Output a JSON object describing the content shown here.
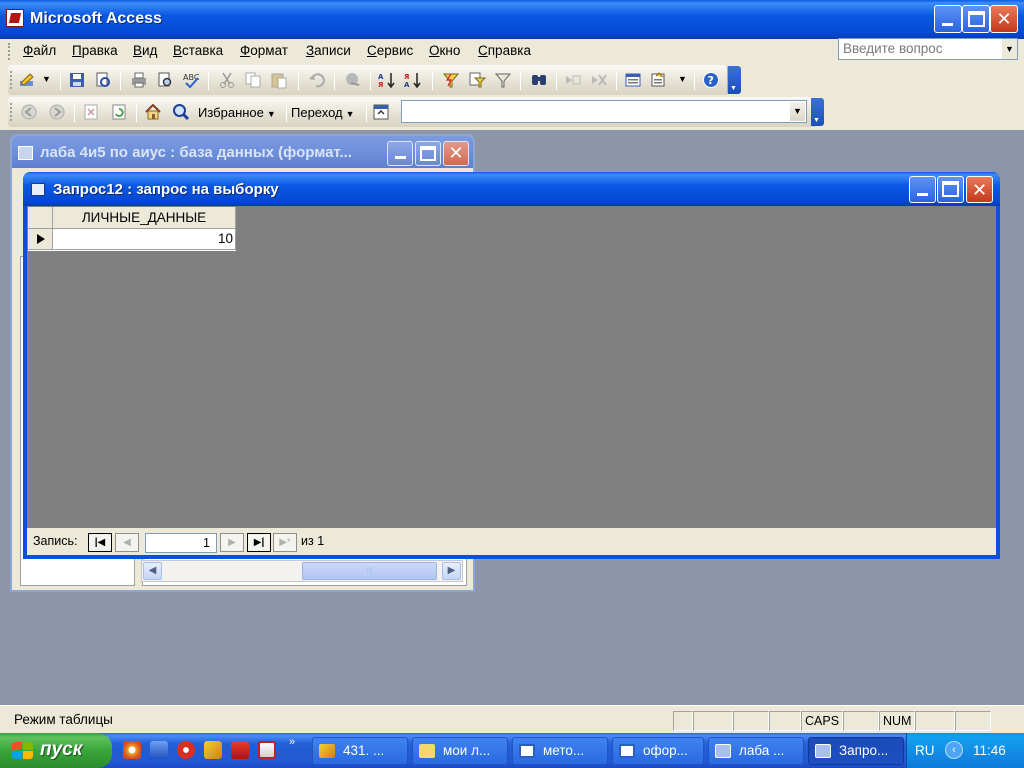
{
  "app": {
    "title": "Microsoft Access"
  },
  "menubar": {
    "items": [
      {
        "label": "Файл",
        "u": "Ф",
        "rest": "айл"
      },
      {
        "label": "Правка",
        "u": "П",
        "rest": "равка"
      },
      {
        "label": "Вид",
        "u": "В",
        "rest": "ид"
      },
      {
        "label": "Вставка",
        "u": "В",
        "rest": "ставка"
      },
      {
        "label": "Формат",
        "u": "Ф",
        "rest": "ормат"
      },
      {
        "label": "Записи",
        "u": "З",
        "rest": "аписи"
      },
      {
        "label": "Сервис",
        "u": "С",
        "rest": "ервис"
      },
      {
        "label": "Окно",
        "u": "О",
        "rest": "кно"
      },
      {
        "label": "Справка",
        "u": "С",
        "rest": "правка"
      }
    ],
    "help_placeholder": "Введите вопрос"
  },
  "web_toolbar": {
    "favorites_label": "Избранное",
    "go_label": "Переход",
    "address_value": ""
  },
  "db_window": {
    "title": "лаба 4и5 по аиус : база данных (формат..."
  },
  "query_window": {
    "title": "Запрос12 : запрос на выборку",
    "column_header": "ЛИЧНЫЕ_ДАННЫЕ",
    "rows": [
      "10"
    ],
    "nav": {
      "label": "Запись:",
      "current": "1",
      "of_label": "из",
      "total": "1"
    }
  },
  "statusbar": {
    "text": "Режим таблицы",
    "caps": "CAPS",
    "num": "NUM"
  },
  "taskbar": {
    "start_label": "пуск",
    "tasks": [
      {
        "label": "431. ...",
        "icon": "lightning-icon",
        "color": "#e3a21a"
      },
      {
        "label": "мои л...",
        "icon": "folder-icon",
        "color": "#f5d76e"
      },
      {
        "label": "мето...",
        "icon": "word-icon",
        "color": "#2b5fbf"
      },
      {
        "label": "офор...",
        "icon": "word-icon",
        "color": "#2b5fbf"
      },
      {
        "label": "лаба ...",
        "icon": "access-db-icon",
        "color": "#a8c0ec"
      },
      {
        "label": "Запро...",
        "icon": "access-query-icon",
        "color": "#a8c0ec"
      }
    ],
    "language": "RU",
    "clock": "11:46"
  },
  "colors": {
    "titlebar_blue": "#0a58e3",
    "mdi_background": "#8d96a8",
    "datasheet_background": "#808080",
    "chrome": "#ece9d8"
  }
}
